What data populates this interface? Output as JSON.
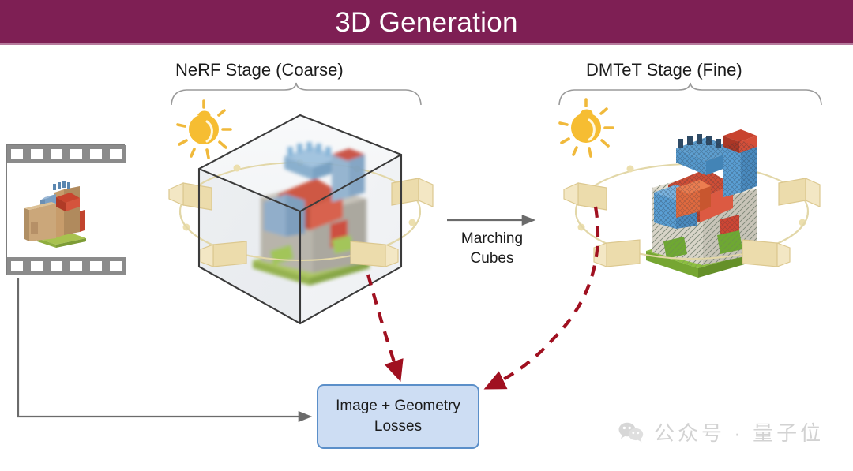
{
  "header": {
    "title": "3D Generation",
    "bg_color": "#7e1f54",
    "text_color": "#ffffff"
  },
  "stages": {
    "left": {
      "label": "NeRF Stage (Coarse)"
    },
    "right": {
      "label": "DMTeT Stage (Fine)"
    }
  },
  "transition": {
    "label_line1": "Marching",
    "label_line2": "Cubes",
    "arrow": "right-arrow"
  },
  "loss_box": {
    "line1": "Image + Geometry",
    "line2": "Losses",
    "fill_color": "#cdddf3",
    "border_color": "#5b8fc9"
  },
  "film_strip": {
    "name": "reference-image-filmstrip",
    "sprocket_count": 6
  },
  "icons": {
    "bulb_left": "lightbulb-icon",
    "bulb_right": "lightbulb-icon",
    "camera_ring_left": "camera-orbit-ring",
    "camera_ring_right": "camera-orbit-ring"
  },
  "colors": {
    "dashed_arrow": "#a01020",
    "solid_arrow": "#6b6b6b",
    "cube_edge": "#3b3b3b",
    "bulb": "#f5b731",
    "camera_box": "#ead9a6"
  },
  "watermark": {
    "text": "公众号 · 量子位",
    "logo": "wechat-icon",
    "color": "#c9c9c9"
  }
}
